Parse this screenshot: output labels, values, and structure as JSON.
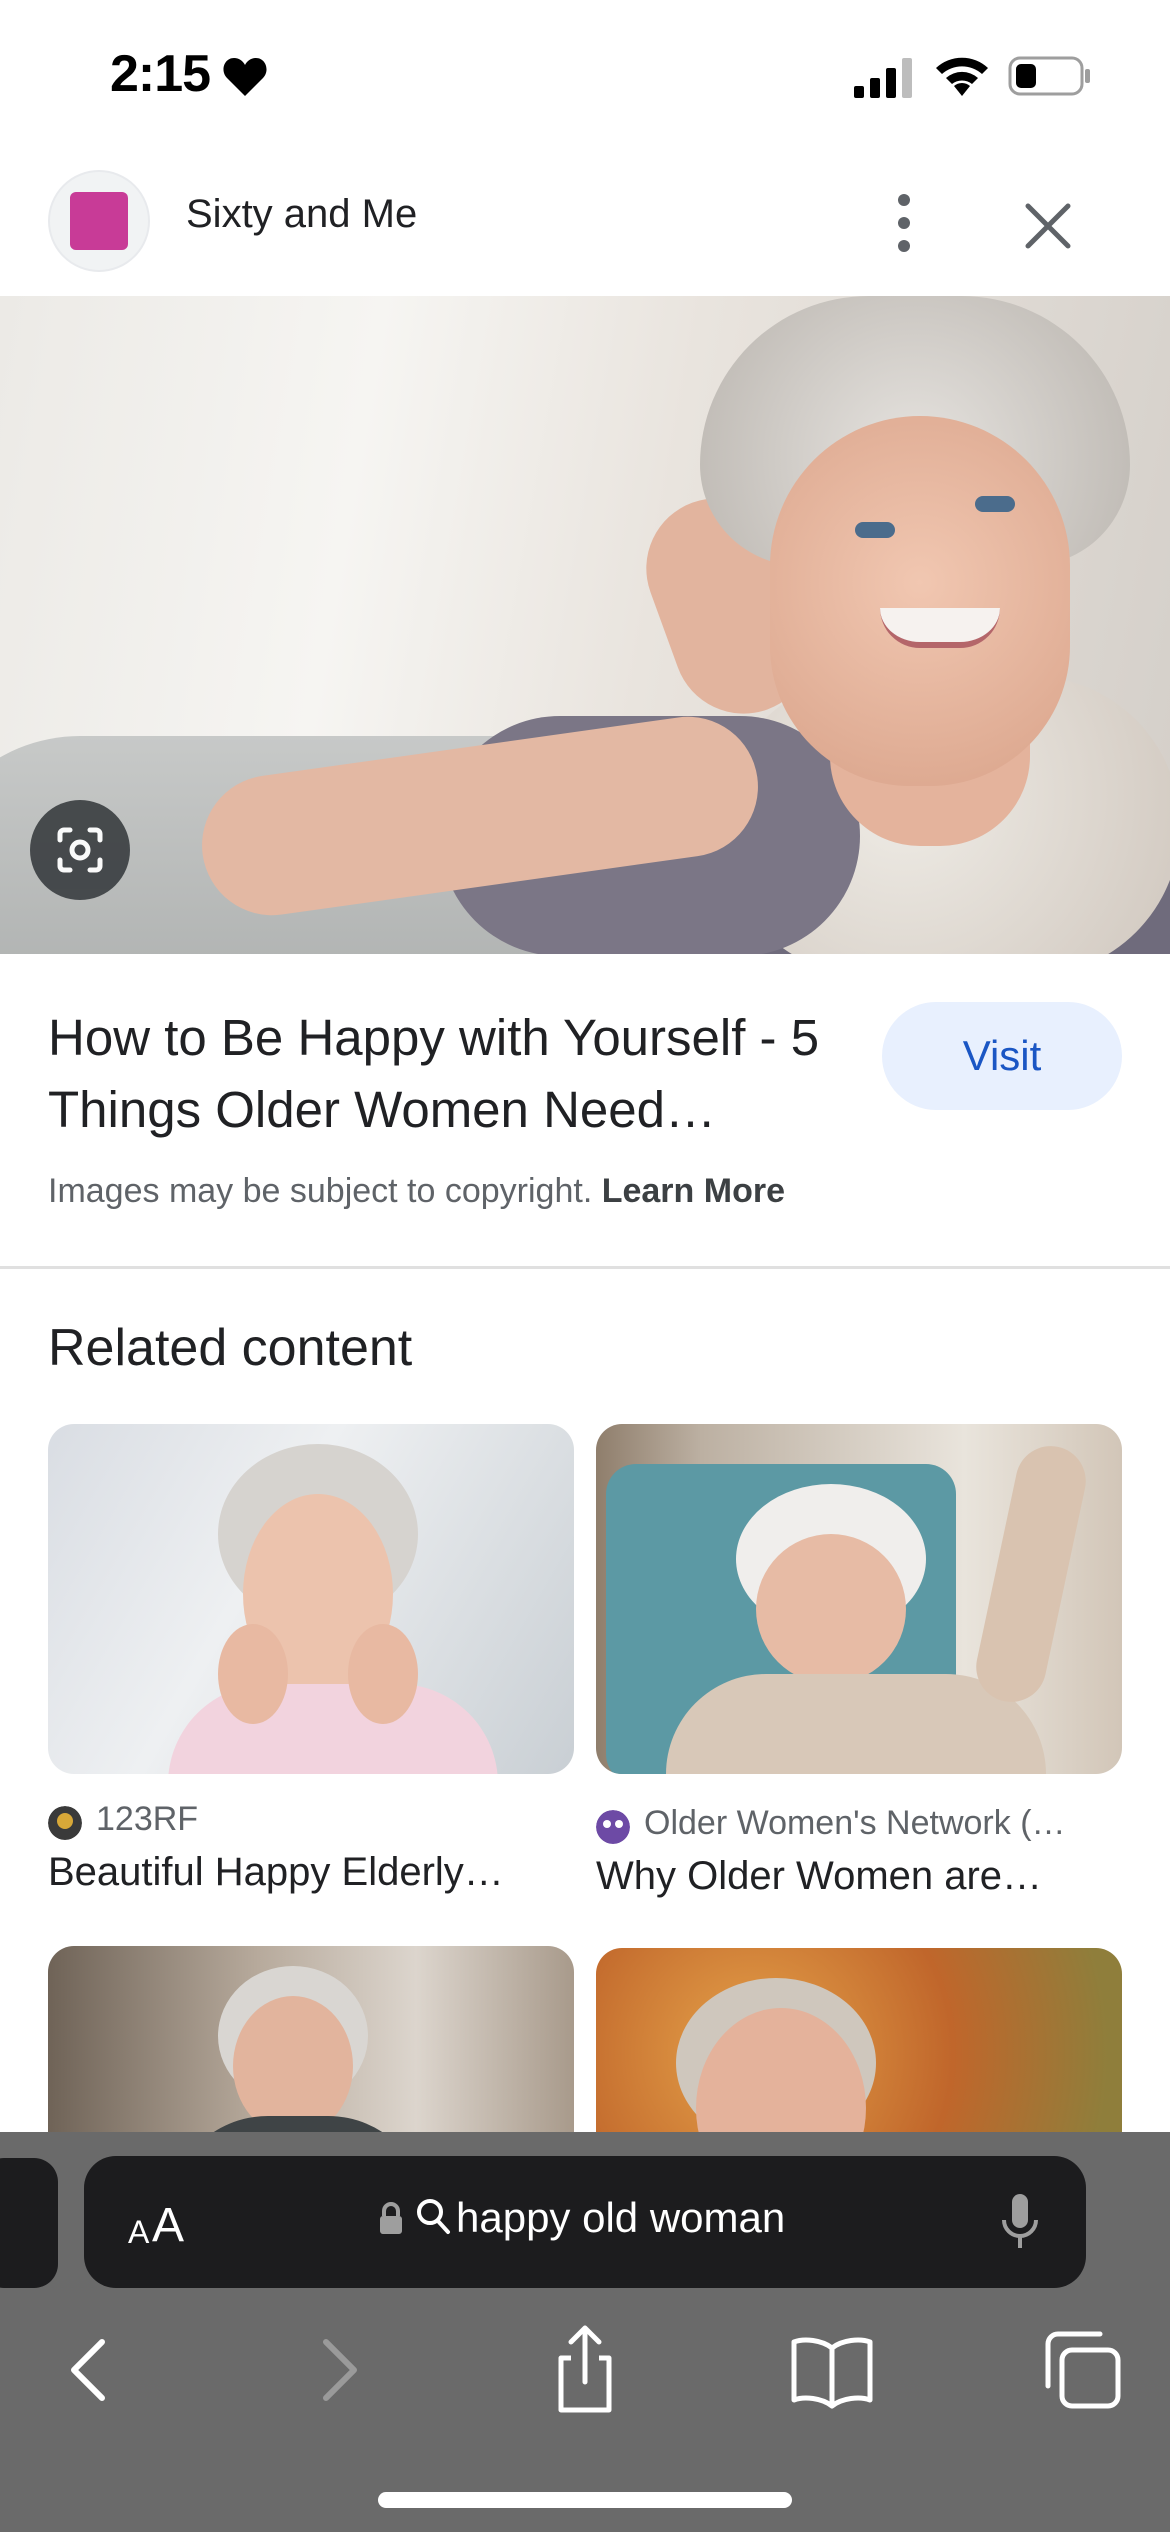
{
  "status_bar": {
    "time": "2:15",
    "icons": [
      "heart-icon",
      "cellular-signal-icon",
      "wifi-icon",
      "battery-icon"
    ]
  },
  "header": {
    "site_name": "Sixty and Me",
    "favicon_color": "#c83b97",
    "icons": [
      "more-vertical-icon",
      "close-icon"
    ]
  },
  "result": {
    "title": "How to Be Happy with Yourself - 5 Things Older Women Need…",
    "visit_label": "Visit",
    "copyright_text": "Images may be subject to copyright.",
    "learn_more_label": "Learn More",
    "lens_icon": "google-lens-icon"
  },
  "related": {
    "heading": "Related content",
    "cards": [
      {
        "source": "123RF",
        "title": "Beautiful Happy Elderly…"
      },
      {
        "source": "Older Women's Network (…",
        "title": "Why Older Women are…"
      },
      {
        "source": "",
        "title": ""
      },
      {
        "source": "",
        "title": ""
      }
    ]
  },
  "browser": {
    "text_size_label_small": "A",
    "text_size_label_large": "A",
    "address_text": "happy old woman",
    "icons": [
      "lock-icon",
      "search-icon",
      "microphone-icon",
      "back-icon",
      "forward-icon",
      "share-icon",
      "bookmarks-icon",
      "tabs-icon"
    ]
  },
  "colors": {
    "accent_blue": "#1a56c4",
    "visit_bg": "#e8f0fe",
    "toolbar_bg": "#6a6a6a",
    "address_bg": "#1c1c1e"
  }
}
